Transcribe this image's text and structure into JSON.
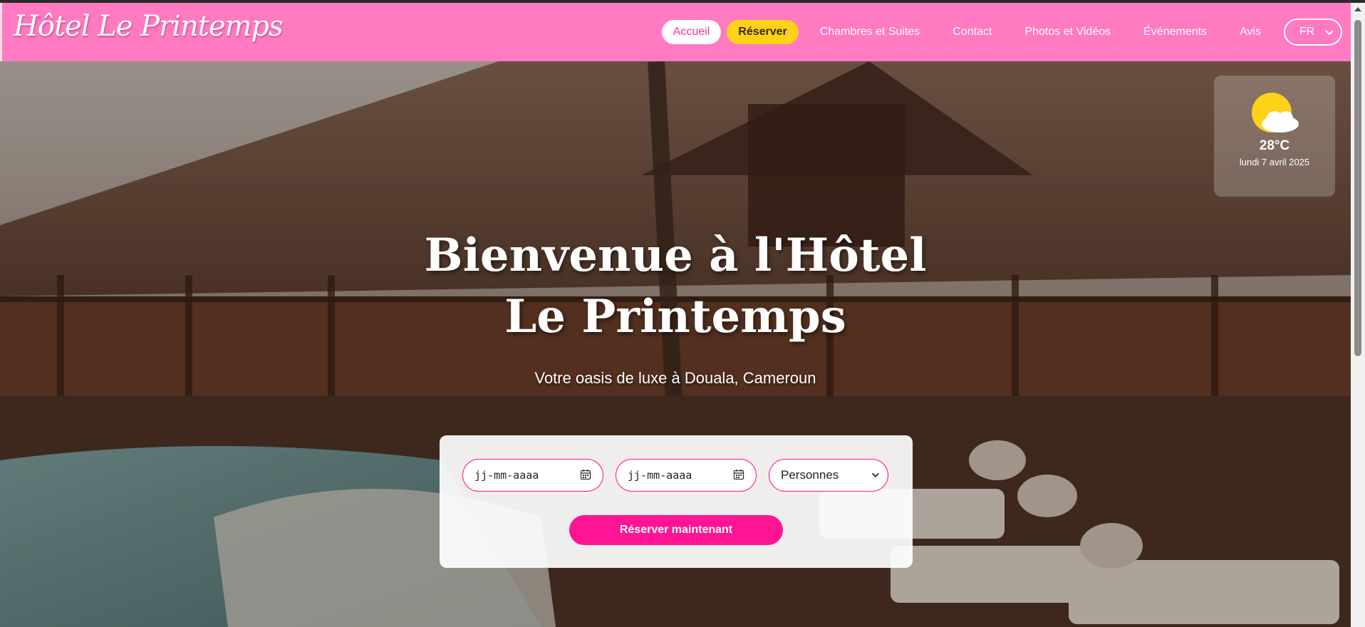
{
  "brand": {
    "logo_text": "Hôtel Le Printemps"
  },
  "nav": {
    "items": [
      {
        "label": "Accueil"
      },
      {
        "label": "Réserver"
      },
      {
        "label": "Chambres et Suites"
      },
      {
        "label": "Contact"
      },
      {
        "label": "Photos et Vidéos"
      },
      {
        "label": "Événements"
      },
      {
        "label": "Avis"
      }
    ],
    "language": "FR"
  },
  "weather": {
    "icon": "partly-cloudy-icon",
    "temperature": "28°C",
    "date": "lundi 7 avril 2025"
  },
  "hero": {
    "title": "Bienvenue à l'Hôtel Le Printemps",
    "subtitle": "Votre oasis de luxe à Douala, Cameroun"
  },
  "booking": {
    "checkin_placeholder": "jj-mm-aaaa",
    "checkout_placeholder": "jj-mm-aaaa",
    "persons_label": "Personnes",
    "submit_label": "Réserver maintenant"
  },
  "colors": {
    "primary_pink": "#ff7ac0",
    "accent_pink": "#ff1493",
    "accent_yellow": "#ffd21a"
  }
}
